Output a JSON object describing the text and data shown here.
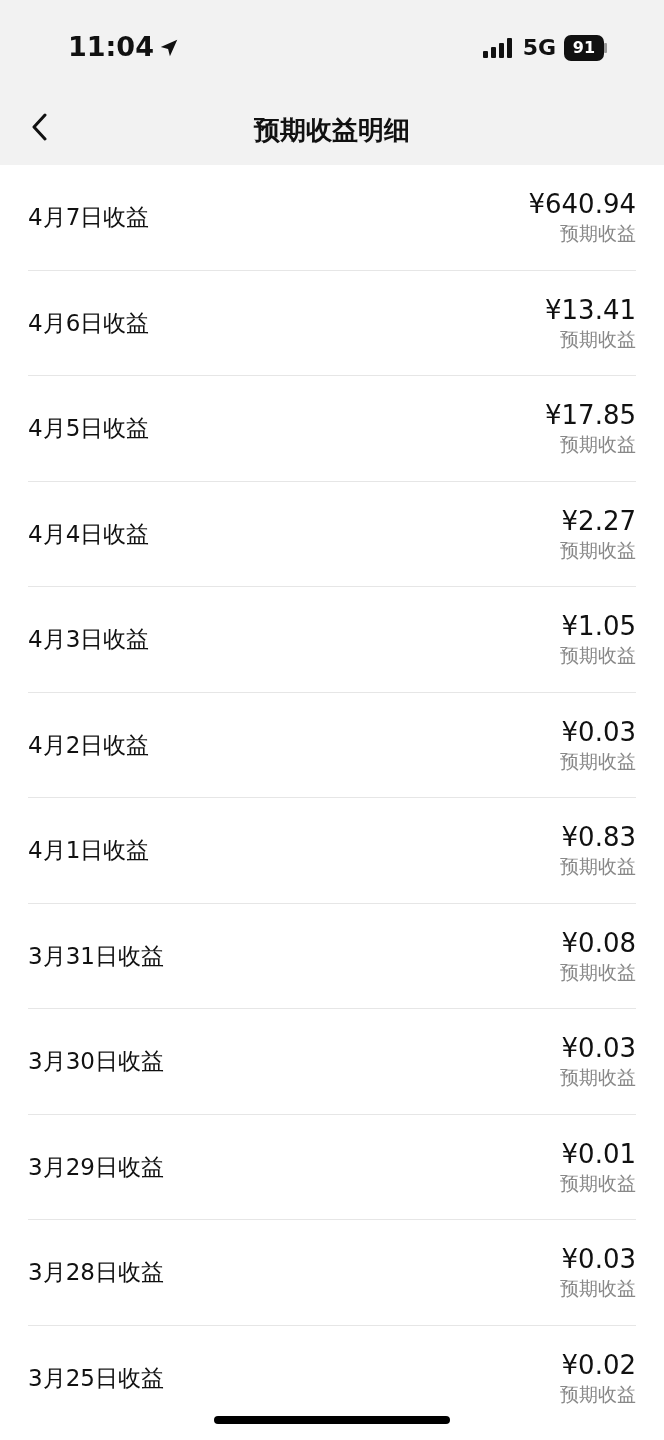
{
  "status_bar": {
    "time": "11:04",
    "network": "5G",
    "battery": "91"
  },
  "header": {
    "title": "预期收益明细"
  },
  "rows": [
    {
      "label": "4月7日收益",
      "amount": "¥640.94",
      "note": "预期收益"
    },
    {
      "label": "4月6日收益",
      "amount": "¥13.41",
      "note": "预期收益"
    },
    {
      "label": "4月5日收益",
      "amount": "¥17.85",
      "note": "预期收益"
    },
    {
      "label": "4月4日收益",
      "amount": "¥2.27",
      "note": "预期收益"
    },
    {
      "label": "4月3日收益",
      "amount": "¥1.05",
      "note": "预期收益"
    },
    {
      "label": "4月2日收益",
      "amount": "¥0.03",
      "note": "预期收益"
    },
    {
      "label": "4月1日收益",
      "amount": "¥0.83",
      "note": "预期收益"
    },
    {
      "label": "3月31日收益",
      "amount": "¥0.08",
      "note": "预期收益"
    },
    {
      "label": "3月30日收益",
      "amount": "¥0.03",
      "note": "预期收益"
    },
    {
      "label": "3月29日收益",
      "amount": "¥0.01",
      "note": "预期收益"
    },
    {
      "label": "3月28日收益",
      "amount": "¥0.03",
      "note": "预期收益"
    },
    {
      "label": "3月25日收益",
      "amount": "¥0.02",
      "note": "预期收益"
    }
  ]
}
